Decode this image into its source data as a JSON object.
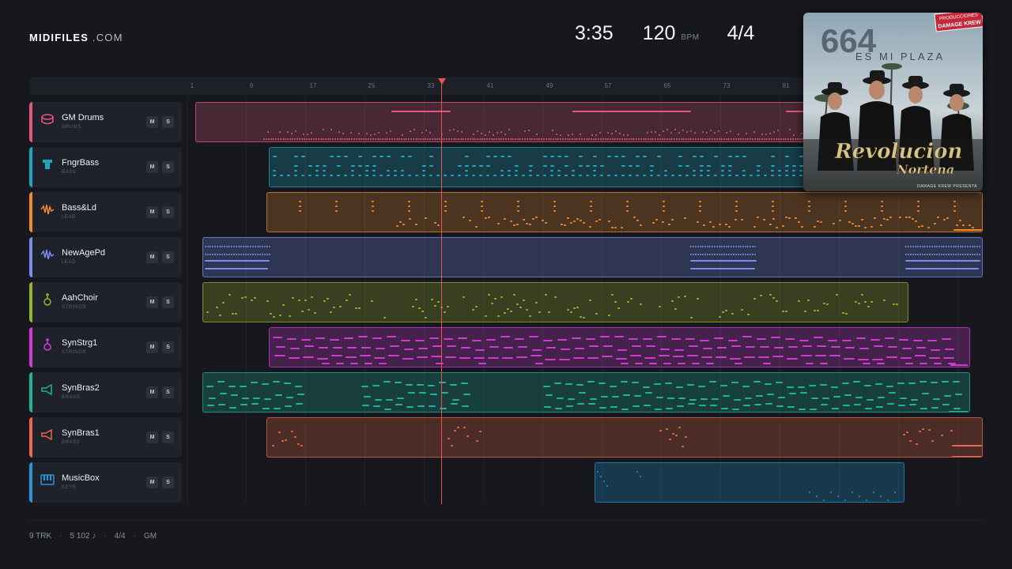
{
  "brand": {
    "name": "MIDIFILES",
    "suffix": ".COM"
  },
  "transport": {
    "time": "3:35",
    "bpm": "120",
    "bpm_unit": "BPM",
    "time_signature": "4/4"
  },
  "ruler": {
    "ticks": [
      "1",
      "9",
      "17",
      "25",
      "33",
      "41",
      "49",
      "57",
      "65",
      "73",
      "81"
    ]
  },
  "tracks": [
    {
      "name": "GM Drums",
      "category": "DRUMS",
      "icon": "drum-icon",
      "color": "#e4577f"
    },
    {
      "name": "FngrBass",
      "category": "BASS",
      "icon": "bass-icon",
      "color": "#1fa5c4"
    },
    {
      "name": "Bass&Ld",
      "category": "LEAD",
      "icon": "waveform-icon",
      "color": "#f08a2a"
    },
    {
      "name": "NewAgePd",
      "category": "LEAD",
      "icon": "waveform-icon",
      "color": "#7b8ef0"
    },
    {
      "name": "AahChoir",
      "category": "STRINGS",
      "icon": "guitar-icon",
      "color": "#9bb22a"
    },
    {
      "name": "SynStrg1",
      "category": "STRINGS",
      "icon": "guitar-icon",
      "color": "#d23ad8"
    },
    {
      "name": "SynBras2",
      "category": "BRASS",
      "icon": "horn-icon",
      "color": "#1fb39b"
    },
    {
      "name": "SynBras1",
      "category": "BRASS",
      "icon": "horn-icon",
      "color": "#ec6848"
    },
    {
      "name": "MusicBox",
      "category": "KEYS",
      "icon": "keyboard-icon",
      "color": "#1f97d8"
    }
  ],
  "buttons": {
    "mute": "M",
    "solo": "S"
  },
  "album_cover": {
    "title_number": "664",
    "subtitle": "ES MI PLAZA",
    "script_line1": "Revolucion",
    "script_line2": "Nortena",
    "footer_text": "DAMAGE KREW PRESENTA",
    "stamp_line1": "PRODUCCIONES",
    "stamp_line2": "DAMAGE KREW"
  },
  "footer": {
    "tracks": "9 TRK",
    "notes": "5 102 ♪",
    "time_signature": "4/4",
    "standard": "GM"
  }
}
